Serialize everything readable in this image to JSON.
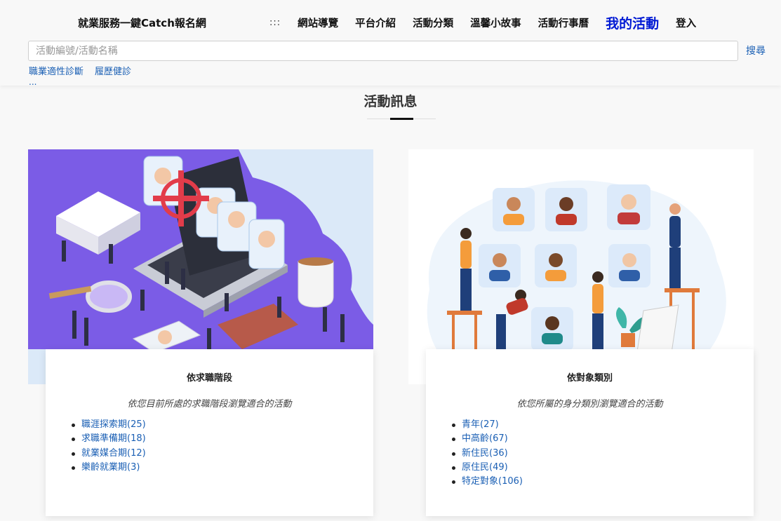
{
  "header": {
    "site_title": "就業服務一鍵Catch報名網",
    "accessibility_link": ":::",
    "nav": [
      {
        "label": "網站導覽"
      },
      {
        "label": "平台介紹"
      },
      {
        "label": "活動分類"
      },
      {
        "label": "溫馨小故事"
      },
      {
        "label": "活動行事曆"
      },
      {
        "label": "我的活動"
      },
      {
        "label": "登入"
      }
    ],
    "search": {
      "placeholder": "活動編號/活動名稱",
      "value": "",
      "button_label": "搜尋"
    },
    "quick_links": [
      {
        "label": "職業適性診斷"
      },
      {
        "label": "履歷健診"
      }
    ],
    "more_label": "..."
  },
  "main": {
    "section_title": "活動訊息",
    "cards": [
      {
        "heading": "依求職階段",
        "description": "依您目前所處的求職階段瀏覽適合的活動",
        "items": [
          "職涯探索期(25)",
          "求職準備期(18)",
          "就業媒合期(12)",
          "樂齡就業期(3)"
        ]
      },
      {
        "heading": "依對象類別",
        "description": "依您所屬的身分類別瀏覽適合的活動",
        "items": [
          "青年(27)",
          "中高齡(67)",
          "新住民(36)",
          "原住民(49)",
          "特定對象(106)"
        ]
      }
    ]
  },
  "colors": {
    "accent_nav": "#0019d4",
    "link": "#1a5fb4",
    "illustration_purple": "#7b5ce6",
    "illustration_light_blue": "#dbe9f8"
  }
}
